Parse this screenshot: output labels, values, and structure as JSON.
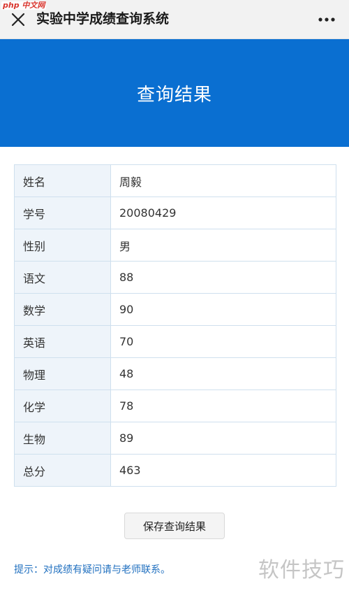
{
  "watermark_top": "中文网",
  "window": {
    "title": "实验中学成绩查询系统"
  },
  "banner": {
    "title": "查询结果"
  },
  "result_table": {
    "rows": [
      {
        "label": "姓名",
        "value": "周毅"
      },
      {
        "label": "学号",
        "value": "20080429"
      },
      {
        "label": "性别",
        "value": "男"
      },
      {
        "label": "语文",
        "value": "88"
      },
      {
        "label": "数学",
        "value": "90"
      },
      {
        "label": "英语",
        "value": "70"
      },
      {
        "label": "物理",
        "value": "48"
      },
      {
        "label": "化学",
        "value": "78"
      },
      {
        "label": "生物",
        "value": "89"
      },
      {
        "label": "总分",
        "value": "463"
      }
    ]
  },
  "actions": {
    "save_label": "保存查询结果"
  },
  "hint": "提示：对成绩有疑问请与老师联系。",
  "watermark_bottom": "软件技巧",
  "colors": {
    "banner": "#0a6fd1",
    "hint": "#1f6fbf",
    "label_bg": "#eef4fa"
  },
  "icons": {
    "close": "close-icon",
    "more": "more-icon"
  }
}
